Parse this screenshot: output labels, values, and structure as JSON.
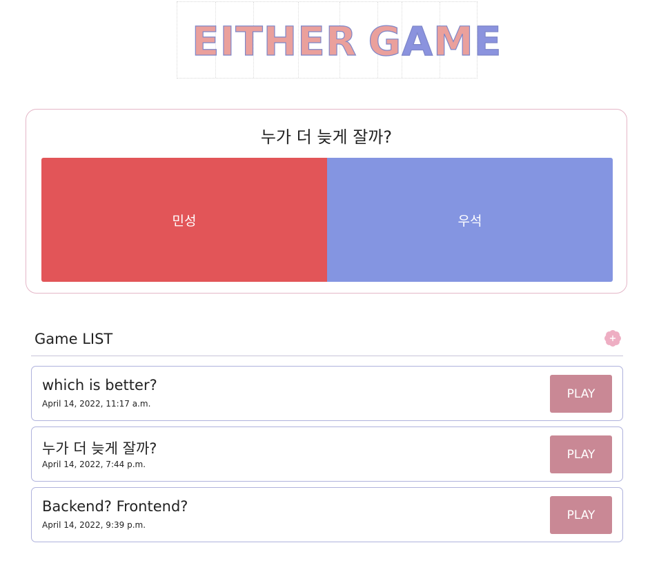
{
  "logo": {
    "word1": "EITHER",
    "word2_g": "G",
    "word2_a": "A",
    "word2_m": "M",
    "word2_e": "E",
    "colors": {
      "pink": "#eaa09c",
      "blue": "#8b93de"
    }
  },
  "question": {
    "title": "누가 더 늦게 잘까?",
    "choice_a": "민성",
    "choice_b": "우석",
    "colors": {
      "choice_a": "#e25558",
      "choice_b": "#8495e1",
      "border": "#e4b6c7"
    }
  },
  "game_list": {
    "title": "Game LIST",
    "add_icon": "plus-flower-icon",
    "games": [
      {
        "title": "which is better?",
        "date": "April 14, 2022, 11:17 a.m.",
        "play_label": "PLAY"
      },
      {
        "title": "누가 더 늦게 잘까?",
        "date": "April 14, 2022, 7:44 p.m.",
        "play_label": "PLAY"
      },
      {
        "title": "Backend? Frontend?",
        "date": "April 14, 2022, 9:39 p.m.",
        "play_label": "PLAY"
      }
    ],
    "colors": {
      "play": "#c98895",
      "row_border": "#aeb1dc"
    }
  }
}
